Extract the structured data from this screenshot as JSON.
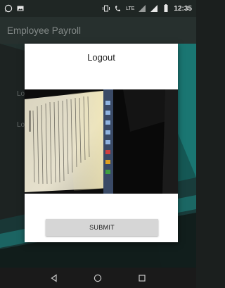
{
  "status_bar": {
    "time": "12:35",
    "network_label": "LTE",
    "icons": [
      "whatsapp-icon",
      "image-icon",
      "vibrate-icon",
      "call-lte-icon",
      "lte-signal-icon",
      "signal-icon",
      "battery-icon"
    ]
  },
  "app_bar": {
    "title": "Employee Payroll"
  },
  "background": {
    "label_1": "Lo",
    "label_2": "Lo"
  },
  "dialog": {
    "title": "Logout",
    "photo_alt": "photo of a laptop screen showing a document",
    "submit_label": "SUBMIT"
  },
  "nav_bar": {
    "icons": [
      "back-icon",
      "home-icon",
      "recents-icon"
    ]
  },
  "colors": {
    "teal_accent": "#1e8a86",
    "dialog_bg": "#ffffff",
    "button_bg": "#d6d6d6"
  }
}
